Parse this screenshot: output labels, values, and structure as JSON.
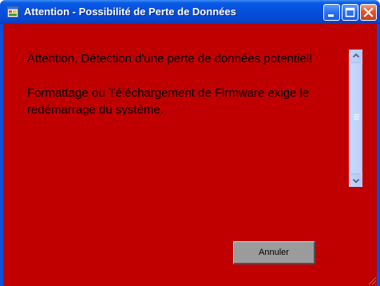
{
  "window": {
    "title": "Attention - Possibilité de Perte de Données",
    "icon": "application-icon",
    "controls": [
      "minimize-icon",
      "maximize-icon",
      "close-icon"
    ]
  },
  "message": {
    "line1": "Attention,  Détection d'une perte de données potentiel!",
    "line2": "Formattage ou Téléchargement de Firmware exige le redémarrage du système."
  },
  "buttons": {
    "cancel_label": "Annuler"
  },
  "colors": {
    "background": "#c00000",
    "titlebar": "#0550dc"
  }
}
